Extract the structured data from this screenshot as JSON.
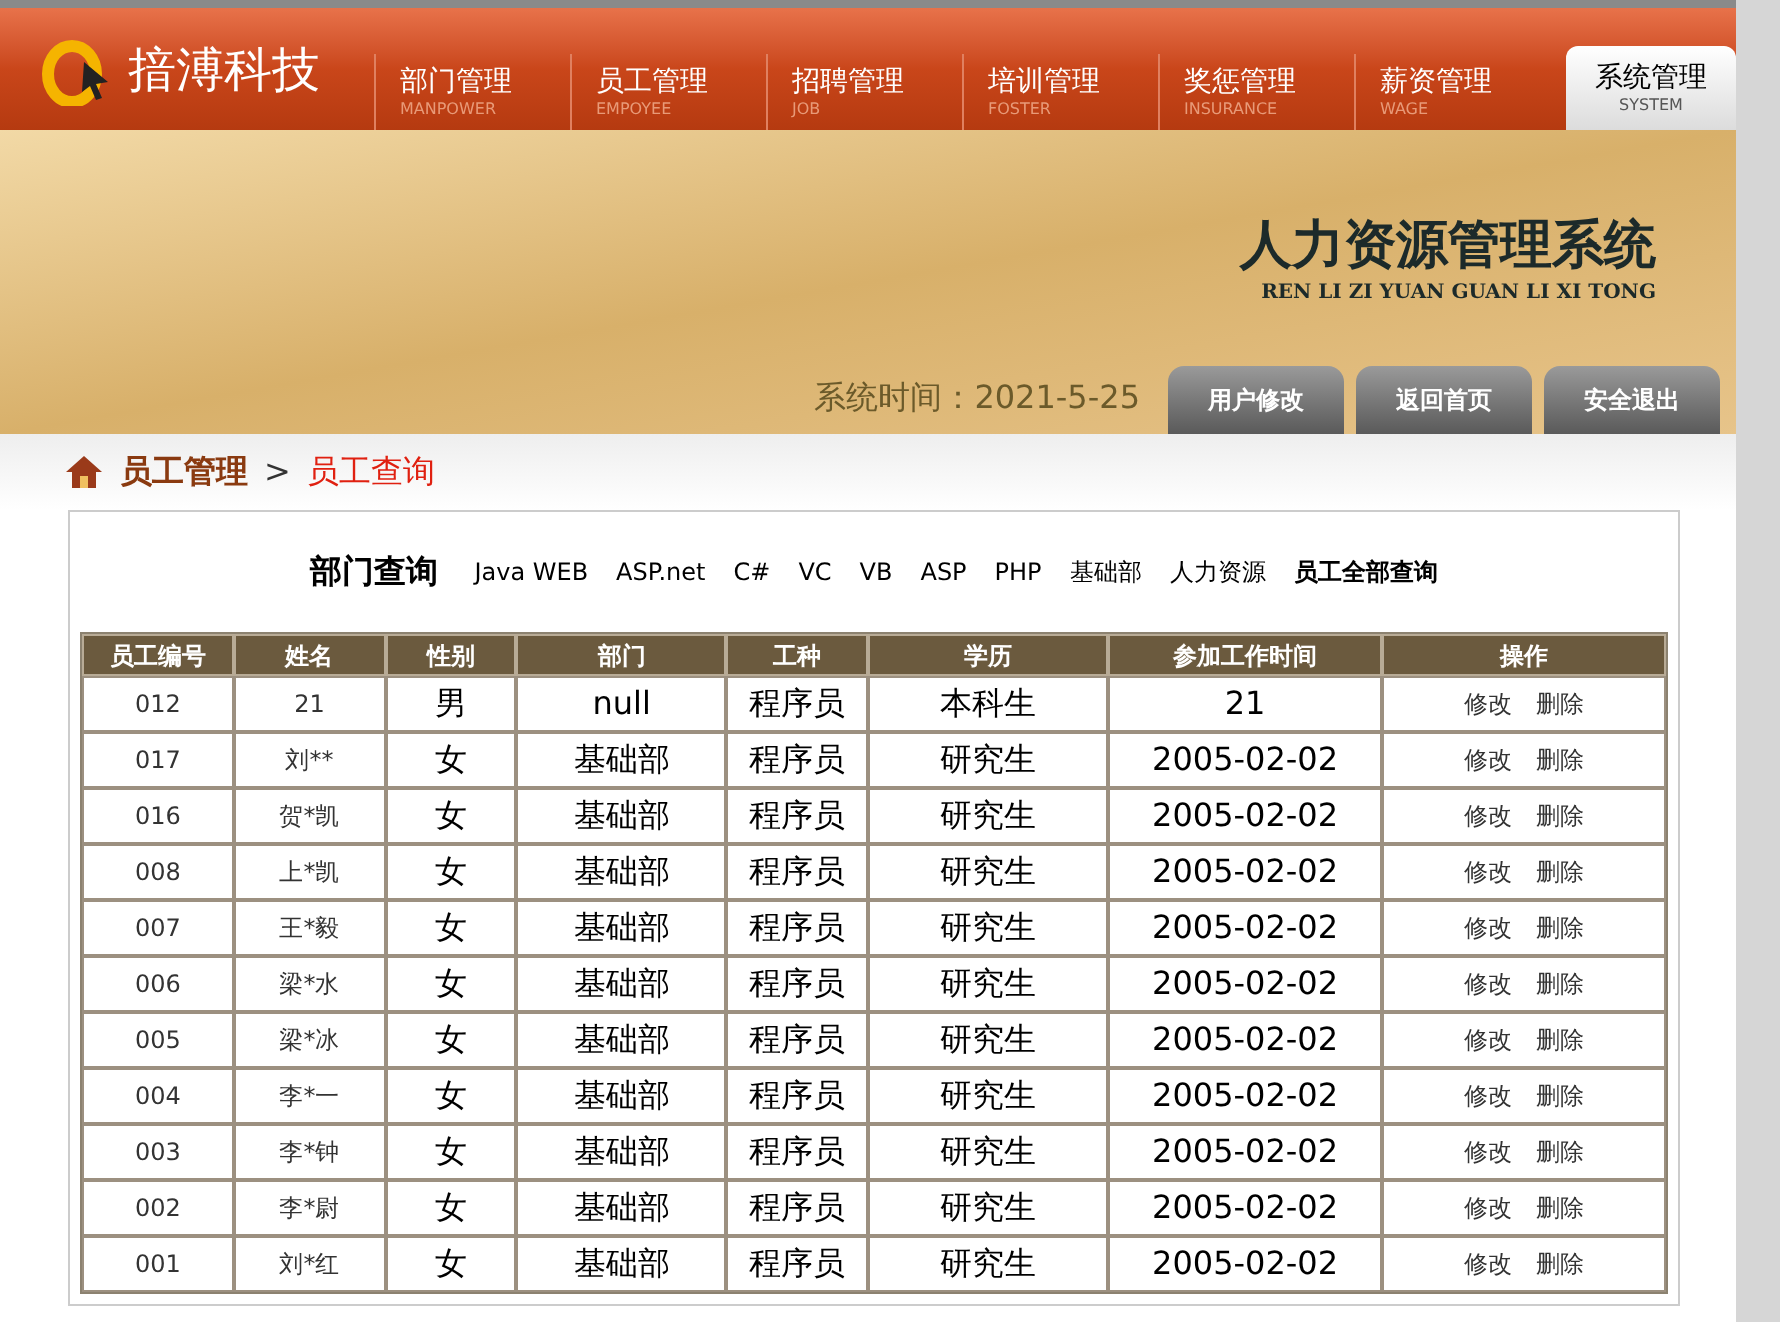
{
  "header": {
    "logo_text": "揞溥科技",
    "nav": [
      {
        "label": "部门管理",
        "sub": "MANPOWER",
        "selected": false
      },
      {
        "label": "员工管理",
        "sub": "EMPOYEE",
        "selected": false
      },
      {
        "label": "招聘管理",
        "sub": "JOB",
        "selected": false
      },
      {
        "label": "培训管理",
        "sub": "FOSTER",
        "selected": false
      },
      {
        "label": "奖惩管理",
        "sub": "INSURANCE",
        "selected": false
      },
      {
        "label": "薪资管理",
        "sub": "WAGE",
        "selected": false
      },
      {
        "label": "系统管理",
        "sub": "SYSTEM",
        "selected": true
      }
    ]
  },
  "banner": {
    "title": "人力资源管理系统",
    "subtitle": "REN LI ZI YUAN GUAN LI XI TONG",
    "system_time": "系统时间：2021-5-25",
    "buttons": [
      "用户修改",
      "返回首页",
      "安全退出"
    ]
  },
  "breadcrumb": {
    "parent": "员工管理",
    "separator": ">",
    "current": "员工查询"
  },
  "filter": {
    "label": "部门查询",
    "links": [
      {
        "label": "Java WEB",
        "bold": false
      },
      {
        "label": "ASP.net",
        "bold": false
      },
      {
        "label": "C#",
        "bold": false
      },
      {
        "label": "VC",
        "bold": false
      },
      {
        "label": "VB",
        "bold": false
      },
      {
        "label": "ASP",
        "bold": false
      },
      {
        "label": "PHP",
        "bold": false
      },
      {
        "label": "基础部",
        "bold": false
      },
      {
        "label": "人力资源",
        "bold": false
      },
      {
        "label": "员工全部查询",
        "bold": true
      }
    ]
  },
  "table": {
    "columns": [
      "员工编号",
      "姓名",
      "性别",
      "部门",
      "工种",
      "学历",
      "参加工作时间",
      "操作"
    ],
    "rows": [
      {
        "id": "012",
        "name": "21",
        "gender": "男",
        "dept": "null",
        "job": "程序员",
        "edu": "本科生",
        "start": "21",
        "actions": [
          "修改",
          "删除"
        ]
      },
      {
        "id": "017",
        "name": "刘**",
        "gender": "女",
        "dept": "基础部",
        "job": "程序员",
        "edu": "研究生",
        "start": "2005-02-02",
        "actions": [
          "修改",
          "删除"
        ]
      },
      {
        "id": "016",
        "name": "贺*凯",
        "gender": "女",
        "dept": "基础部",
        "job": "程序员",
        "edu": "研究生",
        "start": "2005-02-02",
        "actions": [
          "修改",
          "删除"
        ]
      },
      {
        "id": "008",
        "name": "上*凯",
        "gender": "女",
        "dept": "基础部",
        "job": "程序员",
        "edu": "研究生",
        "start": "2005-02-02",
        "actions": [
          "修改",
          "删除"
        ]
      },
      {
        "id": "007",
        "name": "王*毅",
        "gender": "女",
        "dept": "基础部",
        "job": "程序员",
        "edu": "研究生",
        "start": "2005-02-02",
        "actions": [
          "修改",
          "删除"
        ]
      },
      {
        "id": "006",
        "name": "梁*水",
        "gender": "女",
        "dept": "基础部",
        "job": "程序员",
        "edu": "研究生",
        "start": "2005-02-02",
        "actions": [
          "修改",
          "删除"
        ]
      },
      {
        "id": "005",
        "name": "梁*冰",
        "gender": "女",
        "dept": "基础部",
        "job": "程序员",
        "edu": "研究生",
        "start": "2005-02-02",
        "actions": [
          "修改",
          "删除"
        ]
      },
      {
        "id": "004",
        "name": "李*一",
        "gender": "女",
        "dept": "基础部",
        "job": "程序员",
        "edu": "研究生",
        "start": "2005-02-02",
        "actions": [
          "修改",
          "删除"
        ]
      },
      {
        "id": "003",
        "name": "李*钟",
        "gender": "女",
        "dept": "基础部",
        "job": "程序员",
        "edu": "研究生",
        "start": "2005-02-02",
        "actions": [
          "修改",
          "删除"
        ]
      },
      {
        "id": "002",
        "name": "李*尉",
        "gender": "女",
        "dept": "基础部",
        "job": "程序员",
        "edu": "研究生",
        "start": "2005-02-02",
        "actions": [
          "修改",
          "删除"
        ]
      },
      {
        "id": "001",
        "name": "刘*红",
        "gender": "女",
        "dept": "基础部",
        "job": "程序员",
        "edu": "研究生",
        "start": "2005-02-02",
        "actions": [
          "修改",
          "删除"
        ]
      }
    ]
  }
}
